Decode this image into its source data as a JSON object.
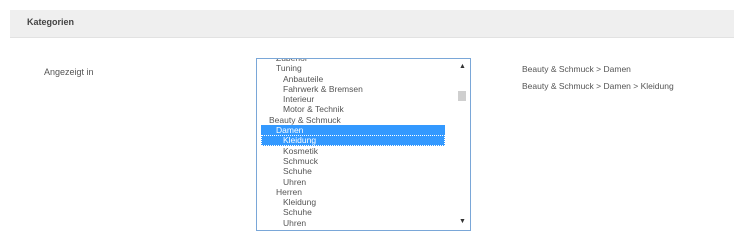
{
  "panel": {
    "title": "Kategorien"
  },
  "field": {
    "label": "Angezeigt in"
  },
  "listbox": {
    "items": [
      {
        "label": "Zubehör",
        "level": 1,
        "selected": false
      },
      {
        "label": "Tuning",
        "level": 1,
        "selected": false
      },
      {
        "label": "Anbauteile",
        "level": 2,
        "selected": false
      },
      {
        "label": "Fahrwerk & Bremsen",
        "level": 2,
        "selected": false
      },
      {
        "label": "Interieur",
        "level": 2,
        "selected": false
      },
      {
        "label": "Motor & Technik",
        "level": 2,
        "selected": false
      },
      {
        "label": "Beauty & Schmuck",
        "level": 0,
        "selected": false
      },
      {
        "label": "Damen",
        "level": 1,
        "selected": true
      },
      {
        "label": "Kleidung",
        "level": 2,
        "selected": true
      },
      {
        "label": "Kosmetik",
        "level": 2,
        "selected": false
      },
      {
        "label": "Schmuck",
        "level": 2,
        "selected": false
      },
      {
        "label": "Schuhe",
        "level": 2,
        "selected": false
      },
      {
        "label": "Uhren",
        "level": 2,
        "selected": false
      },
      {
        "label": "Herren",
        "level": 1,
        "selected": false
      },
      {
        "label": "Kleidung",
        "level": 2,
        "selected": false
      },
      {
        "label": "Schuhe",
        "level": 2,
        "selected": false
      },
      {
        "label": "Uhren",
        "level": 2,
        "selected": false
      }
    ],
    "scroll_up_icon": "chevron-up-icon",
    "scroll_down_icon": "chevron-down-icon"
  },
  "assigned_paths": [
    "Beauty & Schmuck > Damen",
    "Beauty & Schmuck > Damen > Kleidung"
  ],
  "colors": {
    "selection": "#3399ff",
    "header_bg": "#efefef",
    "listbox_border": "#7aa7d8"
  }
}
